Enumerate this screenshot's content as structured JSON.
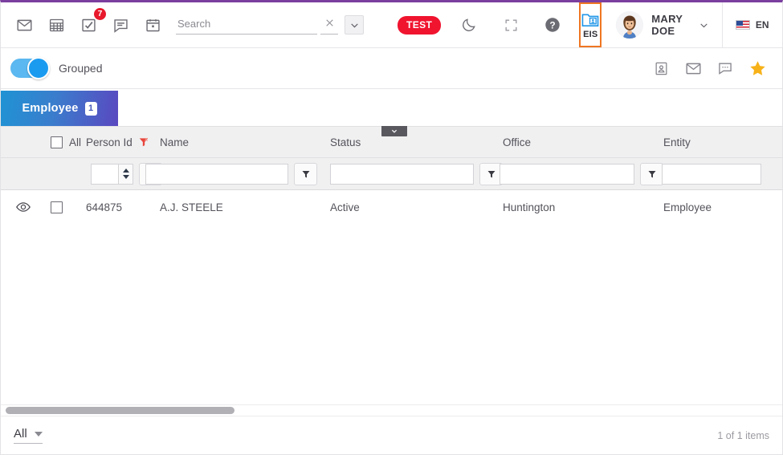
{
  "topbar": {
    "icons": [
      {
        "name": "mail-icon",
        "label": "Mail"
      },
      {
        "name": "grid-calculator-icon",
        "label": "Timesheet"
      },
      {
        "name": "tasks-check-icon",
        "label": "Tasks",
        "badge": "7"
      },
      {
        "name": "messages-icon",
        "label": "Messages"
      },
      {
        "name": "calendar-icon",
        "label": "Calendar"
      }
    ],
    "search": {
      "placeholder": "Search",
      "value": "",
      "clear_label": "×"
    },
    "environment_pill": "TEST",
    "dark_mode_label": "Dark mode",
    "fullscreen_label": "Full screen",
    "help_label": "Help",
    "module": {
      "label": "EIS",
      "icon": "folder-person-icon",
      "highlight_color": "#ef7622"
    },
    "user": {
      "name": "MARY DOE",
      "avatar": "user-avatar"
    },
    "language": {
      "code": "EN",
      "flag": "us-flag-icon"
    },
    "menu_label": "List menu"
  },
  "subbar": {
    "toggle": {
      "label": "Grouped",
      "state": "on",
      "on_color": "#1b9bf0"
    },
    "icons": [
      {
        "name": "contact-card-icon",
        "label": "Contact card"
      },
      {
        "name": "envelope-icon",
        "label": "Send email"
      },
      {
        "name": "chat-bubble-icon",
        "label": "Chat"
      },
      {
        "name": "star-icon",
        "label": "Favorite",
        "color": "#f7b219"
      }
    ]
  },
  "tabs": [
    {
      "label": "Employee",
      "badge": "1",
      "active": true
    }
  ],
  "grid": {
    "select_all_label": "All",
    "columns": [
      {
        "key": "person_id",
        "label": "Person Id",
        "filtered": true,
        "filter_icon": "clear-filter-icon"
      },
      {
        "key": "name",
        "label": "Name"
      },
      {
        "key": "status",
        "label": "Status"
      },
      {
        "key": "office",
        "label": "Office"
      },
      {
        "key": "entity",
        "label": "Entity"
      }
    ],
    "filters": {
      "person_id": "",
      "name": "",
      "status": "",
      "office": "",
      "entity": ""
    },
    "rows": [
      {
        "person_id": "644875",
        "name": "A.J. STEELE",
        "status": "Active",
        "office": "Huntington",
        "entity": "Employee"
      }
    ]
  },
  "footer": {
    "page_size": "All",
    "items_text": "1 of 1 items"
  }
}
